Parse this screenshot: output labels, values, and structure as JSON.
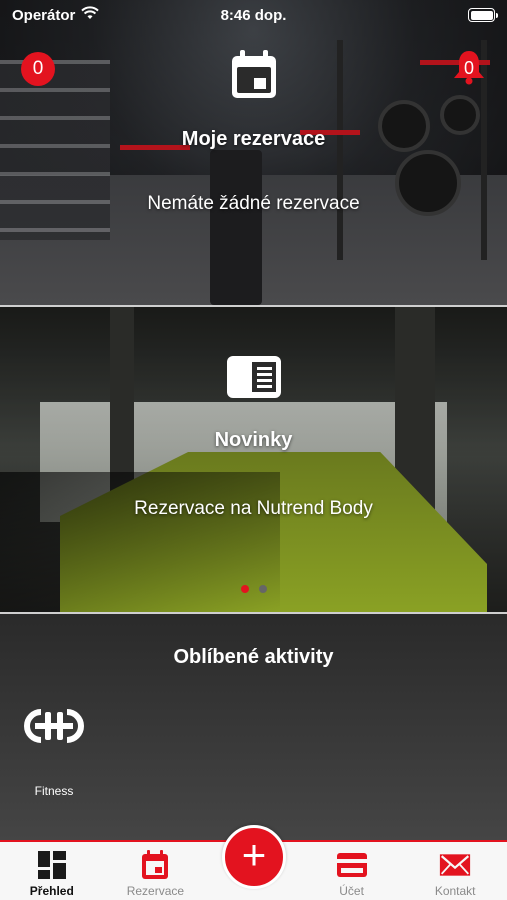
{
  "status_bar": {
    "carrier": "Operátor",
    "time": "8:46 dop."
  },
  "reservations_panel": {
    "badge_count": "0",
    "notification_count": "0",
    "title": "Moje rezervace",
    "subtitle": "Nemáte žádné rezervace",
    "icon": "calendar-icon"
  },
  "news_panel": {
    "title": "Novinky",
    "subtitle": "Rezervace na Nutrend Body",
    "icon": "newspaper-icon",
    "page_count": 2,
    "active_page": 1
  },
  "favorites": {
    "title": "Oblíbené aktivity",
    "items": [
      {
        "label": "Fitness",
        "icon": "dumbbell-icon"
      }
    ]
  },
  "tabbar": {
    "items": [
      {
        "label": "Přehled",
        "icon": "dashboard-icon",
        "active": true
      },
      {
        "label": "Rezervace",
        "icon": "calendar-icon",
        "active": false
      },
      {
        "label": "Účet",
        "icon": "credit-card-icon",
        "active": false
      },
      {
        "label": "Kontakt",
        "icon": "envelope-icon",
        "active": false
      }
    ],
    "center_button": "+"
  },
  "colors": {
    "accent": "#e3131f",
    "tabbar_bg": "#f7f7f7",
    "inactive_text": "#8a8a8a"
  }
}
